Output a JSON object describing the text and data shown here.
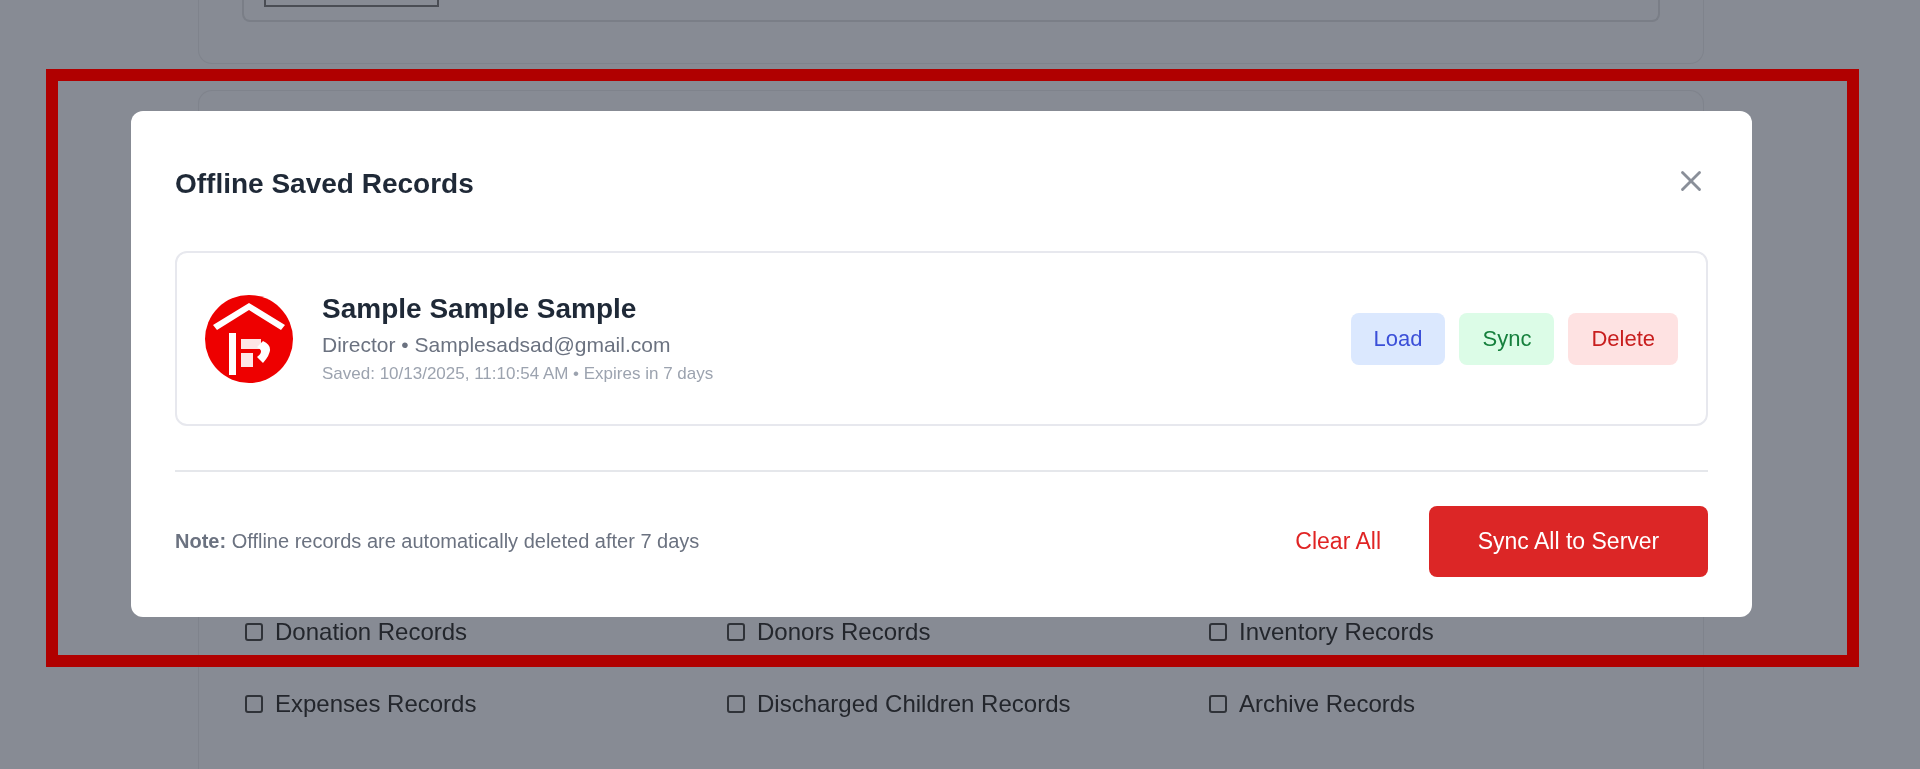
{
  "background": {
    "checkboxes": [
      {
        "label": "Donation Records",
        "checked": false
      },
      {
        "label": "Donors Records",
        "checked": false
      },
      {
        "label": "Inventory Records",
        "checked": false
      },
      {
        "label": "Expenses Records",
        "checked": false
      },
      {
        "label": "Discharged Children Records",
        "checked": false
      },
      {
        "label": "Archive Records",
        "checked": false
      }
    ]
  },
  "dialog": {
    "title": "Offline Saved Records",
    "records": [
      {
        "name": "Sample Sample Sample",
        "subtitle": "Director • Samplesadsad@gmail.com",
        "saved": "Saved: 10/13/2025, 11:10:54 AM • Expires in 7 days",
        "actions": [
          {
            "label": "Load",
            "kind": "load"
          },
          {
            "label": "Sync",
            "kind": "sync"
          },
          {
            "label": "Delete",
            "kind": "delete"
          }
        ]
      }
    ],
    "note": "**Note:** Offline records are automatically deleted after 7 days",
    "footer_buttons": [
      {
        "label": "Clear All",
        "kind": "link"
      },
      {
        "label": "Sync All to Server",
        "kind": "primary"
      }
    ]
  }
}
